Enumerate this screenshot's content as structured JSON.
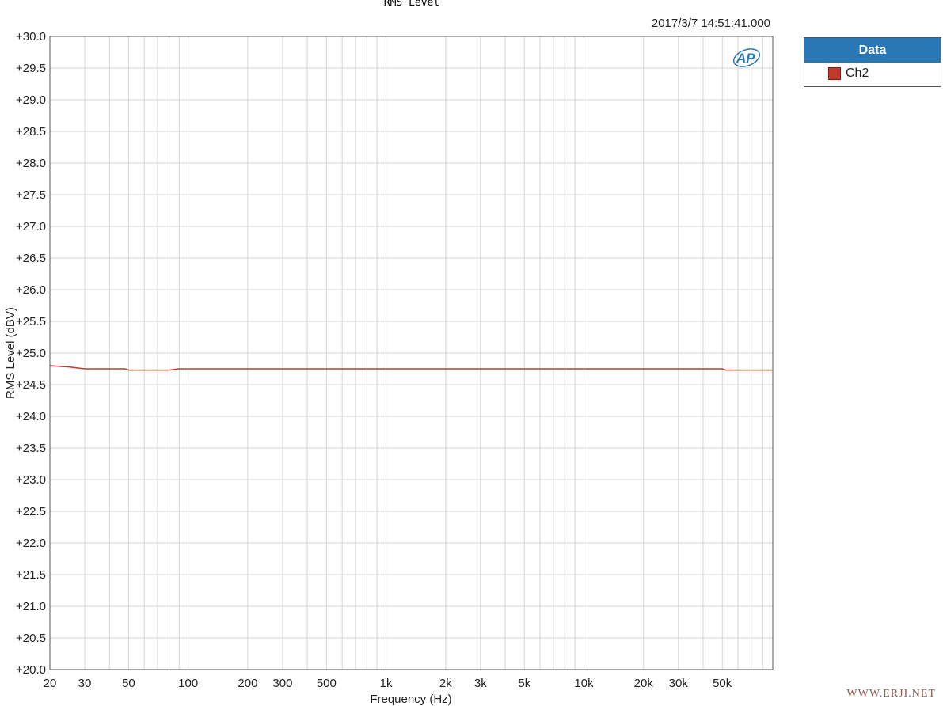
{
  "chart_data": {
    "type": "line",
    "title": "RMS Level",
    "timestamp": "2017/3/7 14:51:41.000",
    "xlabel": "Frequency (Hz)",
    "ylabel": "RMS Level (dBV)",
    "x_scale": "log",
    "xlim": [
      20,
      90000
    ],
    "ylim": [
      20.0,
      30.0
    ],
    "grid": true,
    "legend_position": "right-top",
    "legend_title": "Data",
    "x_ticks": [
      {
        "value": 20,
        "label": "20"
      },
      {
        "value": 30,
        "label": "30"
      },
      {
        "value": 50,
        "label": "50"
      },
      {
        "value": 100,
        "label": "100"
      },
      {
        "value": 200,
        "label": "200"
      },
      {
        "value": 300,
        "label": "300"
      },
      {
        "value": 500,
        "label": "500"
      },
      {
        "value": 1000,
        "label": "1k"
      },
      {
        "value": 2000,
        "label": "2k"
      },
      {
        "value": 3000,
        "label": "3k"
      },
      {
        "value": 5000,
        "label": "5k"
      },
      {
        "value": 10000,
        "label": "10k"
      },
      {
        "value": 20000,
        "label": "20k"
      },
      {
        "value": 30000,
        "label": "30k"
      },
      {
        "value": 50000,
        "label": "50k"
      }
    ],
    "y_ticks": [
      "+30.0",
      "+29.5",
      "+29.0",
      "+28.5",
      "+28.0",
      "+27.5",
      "+27.0",
      "+26.5",
      "+26.0",
      "+25.5",
      "+25.0",
      "+24.5",
      "+24.0",
      "+23.5",
      "+23.0",
      "+22.5",
      "+22.0",
      "+21.5",
      "+21.0",
      "+20.5",
      "+20.0"
    ],
    "series": [
      {
        "name": "Ch2",
        "color": "#c0392b",
        "x": [
          20,
          25,
          30,
          40,
          48,
          50,
          60,
          80,
          90,
          100,
          200,
          500,
          1000,
          2000,
          5000,
          10000,
          20000,
          50000,
          52000,
          60000,
          90000
        ],
        "y": [
          24.8,
          24.78,
          24.75,
          24.75,
          24.75,
          24.73,
          24.73,
          24.73,
          24.75,
          24.75,
          24.75,
          24.75,
          24.75,
          24.75,
          24.75,
          24.75,
          24.75,
          24.75,
          24.73,
          24.73,
          24.73
        ]
      }
    ]
  },
  "colors": {
    "grid": "#d4d4d4",
    "frame": "#555555",
    "legend_header": "#2a77b6"
  },
  "logo_icon": "ap-logo-icon",
  "watermark": "WWW.ERJI.NET"
}
